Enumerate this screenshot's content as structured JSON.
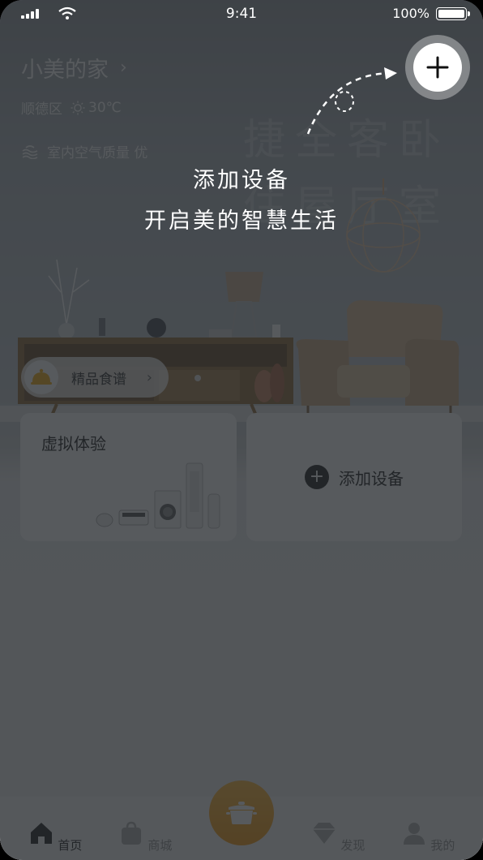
{
  "status_bar": {
    "time": "9:41",
    "battery": "100%"
  },
  "home": {
    "title": "小美的家",
    "chevron": "›"
  },
  "location": {
    "district": "顺德区",
    "temperature": "30℃"
  },
  "air": {
    "label": "室内空气质量 优"
  },
  "wall_text": {
    "line1": "捷全客卧",
    "line2": "住屋厅室"
  },
  "hint": {
    "line1": "添加设备",
    "line2": "开启美的智慧生活"
  },
  "recipe_chip": {
    "label": "精品食谱",
    "chevron": "›"
  },
  "virtual_card": {
    "title": "虚拟体验"
  },
  "add_card": {
    "label": "添加设备",
    "plus": "+"
  },
  "tabs": [
    {
      "label": "首页",
      "icon": "home-icon",
      "active": true
    },
    {
      "label": "商城",
      "icon": "bag-icon",
      "active": false
    },
    {
      "label": "发现",
      "icon": "diamond-icon",
      "active": false
    },
    {
      "label": "我的",
      "icon": "person-icon",
      "active": false
    }
  ],
  "center_button": {
    "icon": "cooking-pot-icon"
  },
  "colors": {
    "accent": "#f39200",
    "overlay": "#2c3034"
  }
}
